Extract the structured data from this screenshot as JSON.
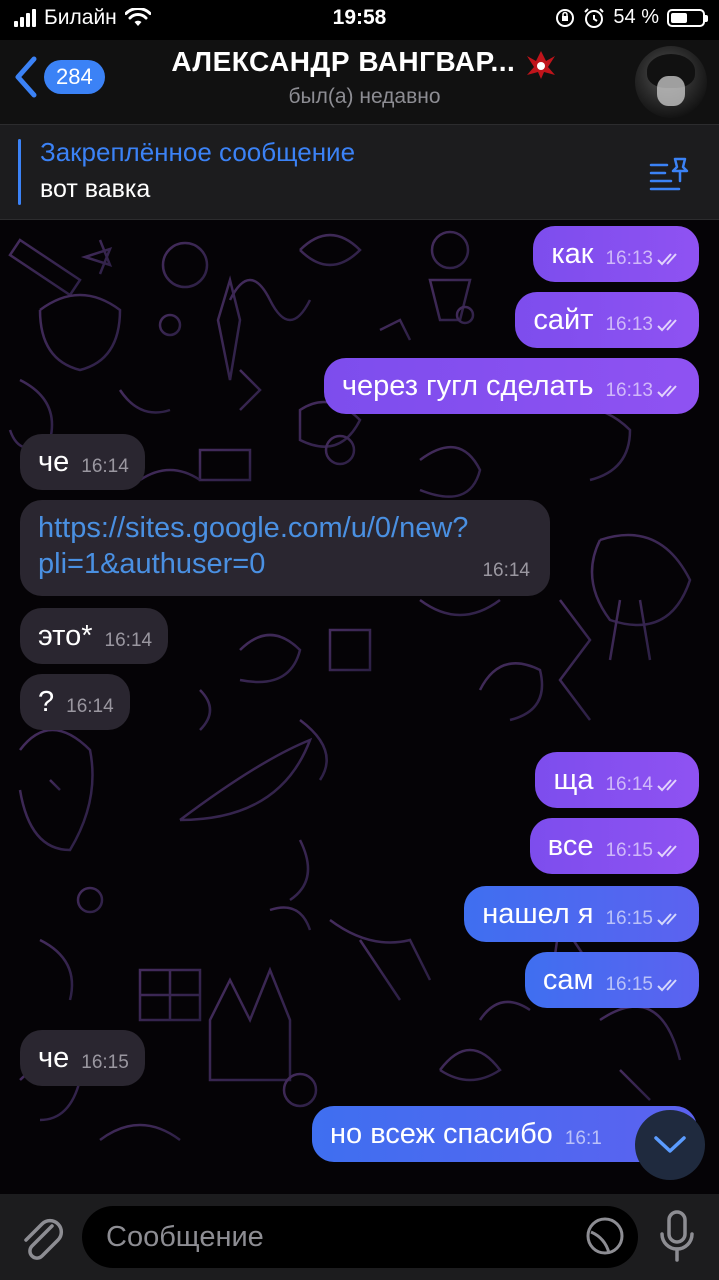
{
  "status_bar": {
    "carrier": "Билайн",
    "time": "19:58",
    "battery_percent": "54 %",
    "battery_level": 0.54
  },
  "header": {
    "back_count": "284",
    "title": "АЛЕКСАНДР ВАНГВАР...",
    "status": "был(а) недавно"
  },
  "pinned": {
    "title": "Закреплённое сообщение",
    "text": "вот вавка"
  },
  "messages": [
    {
      "dir": "out",
      "text": "как",
      "time": "16:13",
      "read": true
    },
    {
      "dir": "out",
      "text": "сайт",
      "time": "16:13",
      "read": true
    },
    {
      "dir": "out",
      "text": "через гугл сделать",
      "time": "16:13",
      "read": true
    },
    {
      "dir": "in",
      "text": "че",
      "time": "16:14"
    },
    {
      "dir": "in",
      "text": "https://sites.google.com/u/0/new?pli=1&authuser=0",
      "text_line1": "https://sites.google.com/u/0/new?",
      "text_line2": "pli=1&authuser=0",
      "time": "16:14",
      "is_link": true
    },
    {
      "dir": "in",
      "text": "это*",
      "time": "16:14"
    },
    {
      "dir": "in",
      "text": "?",
      "time": "16:14"
    },
    {
      "dir": "out",
      "text": "ща",
      "time": "16:14",
      "read": true
    },
    {
      "dir": "out",
      "text": "все",
      "time": "16:15",
      "read": true
    },
    {
      "dir": "out",
      "text": "нашел я",
      "time": "16:15",
      "read": true
    },
    {
      "dir": "out",
      "text": "сам",
      "time": "16:15",
      "read": true
    },
    {
      "dir": "in",
      "text": "че",
      "time": "16:15"
    },
    {
      "dir": "out",
      "text": "но всеж спасибо",
      "time": "16:1"
    }
  ],
  "input": {
    "placeholder": "Сообщение"
  },
  "colors": {
    "accent": "#3b82f6",
    "outgoing_bubble": "#8a50f0",
    "incoming_bubble": "#2a2630"
  }
}
